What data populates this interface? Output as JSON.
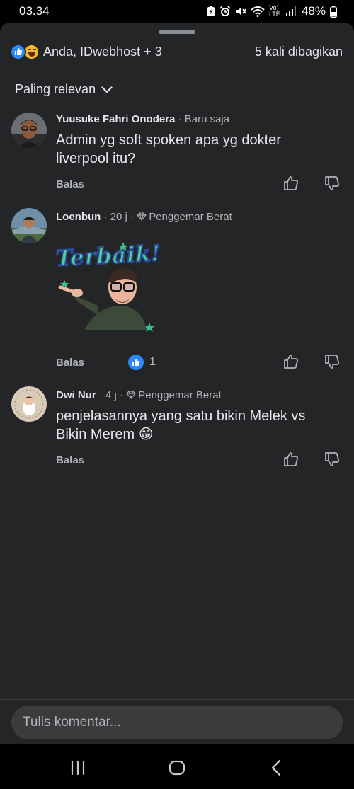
{
  "status": {
    "time": "03.34",
    "network_label": "Vo) LTE",
    "battery": "48%"
  },
  "header": {
    "reaction_names": "Anda, IDwebhost + 3",
    "share_count": "5 kali dibagikan",
    "reaction_icons": [
      "like-icon",
      "haha-icon"
    ]
  },
  "sort": {
    "label": "Paling relevan"
  },
  "comments": [
    {
      "author": "Yuusuke Fahri Onodera",
      "meta": " · Baru saja",
      "text": "Admin yg soft spoken apa yg dokter liverpool itu?",
      "reply": "Balas"
    },
    {
      "author": "Loenbun",
      "meta": " · 20 j · ",
      "badge": "Penggemar Berat",
      "sticker_text": "Terbaik!",
      "reply": "Balas",
      "likes": "1"
    },
    {
      "author": "Dwi Nur",
      "meta": " · 4 j · ",
      "badge": "Penggemar Berat",
      "text": "penjelasannya yang satu bikin Melek vs Bikin Merem",
      "emoji": "😁",
      "reply": "Balas"
    }
  ],
  "composer": {
    "placeholder": "Tulis komentar..."
  },
  "colors": {
    "sheet_bg": "#242526",
    "accent_blue": "#2d88ff",
    "text_primary": "#e4e6eb",
    "text_secondary": "#b0b3b8"
  }
}
